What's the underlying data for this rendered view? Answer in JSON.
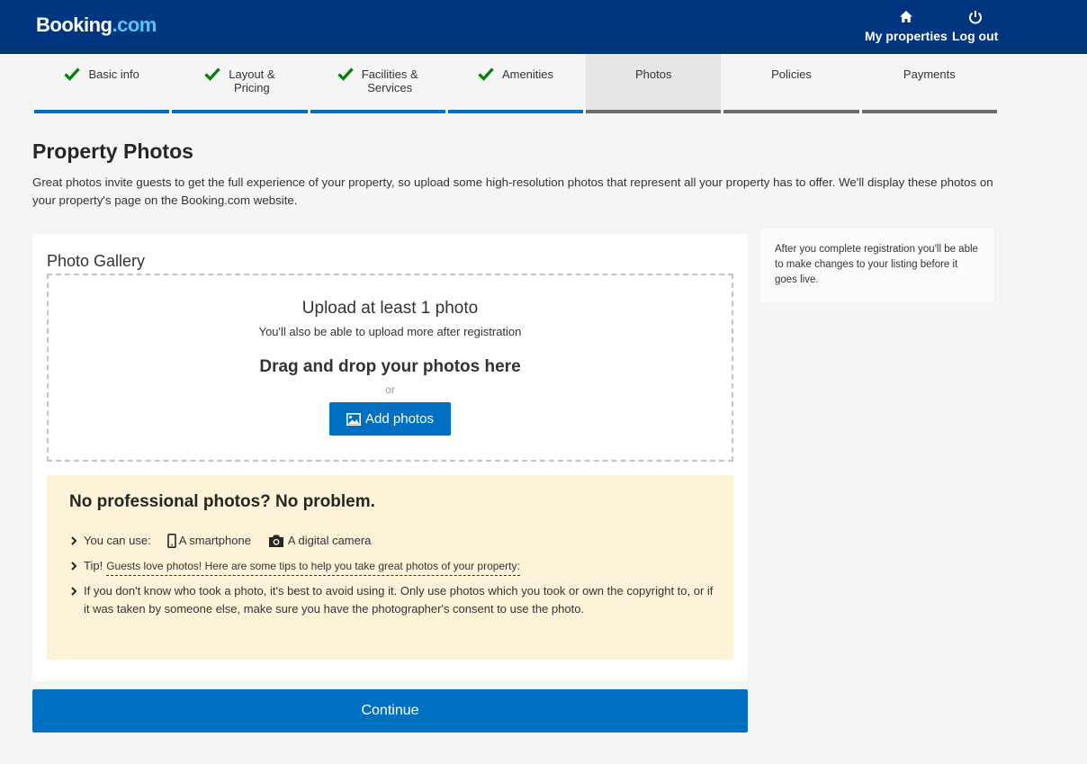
{
  "header": {
    "logo": {
      "main": "Booking",
      "dot": ".",
      "suffix": "com"
    },
    "nav": [
      {
        "label": "My properties",
        "icon": "home-icon"
      },
      {
        "label": "Log out",
        "icon": "power-icon"
      }
    ]
  },
  "steps": [
    {
      "label": "Basic info",
      "state": "done"
    },
    {
      "label": "Layout &\nPricing",
      "state": "done"
    },
    {
      "label": "Facilities &\nServices",
      "state": "done"
    },
    {
      "label": "Amenities",
      "state": "done"
    },
    {
      "label": "Photos",
      "state": "active"
    },
    {
      "label": "Policies",
      "state": "pending"
    },
    {
      "label": "Payments",
      "state": "pending"
    }
  ],
  "page": {
    "title": "Property Photos",
    "intro": "Great photos invite guests to get the full experience of your property, so upload some high-resolution photos that represent all your property has to offer. We'll display these photos on your property's page on the Booking.com website."
  },
  "gallery": {
    "title": "Photo Gallery",
    "upload_title": "Upload at least 1 photo",
    "upload_sub": "You'll also be able to upload more after registration",
    "drag_text": "Drag and drop your photos here",
    "or_text": "or",
    "add_button": "Add photos"
  },
  "tips": {
    "title": "No professional photos? No problem.",
    "you_can_use": "You can use:",
    "smartphone": "A smartphone",
    "camera": "A digital camera",
    "tip_prefix": "Tip!",
    "tip_link": "Guests love photos! Here are some tips to help you take great photos of your property:",
    "copyright": "If you don't know who took a photo, it's best to avoid using it. Only use photos which you took or own the copyright to, or if it was taken by someone else, make sure you have the photographer's consent to use the photo."
  },
  "continue_label": "Continue",
  "aside": {
    "text": "After you complete registration you'll be able to make changes to your listing before it goes live."
  },
  "colors": {
    "header_bg": "#003580",
    "primary": "#0071c2",
    "check_green": "#008009",
    "tips_bg": "#fdf3d8"
  }
}
